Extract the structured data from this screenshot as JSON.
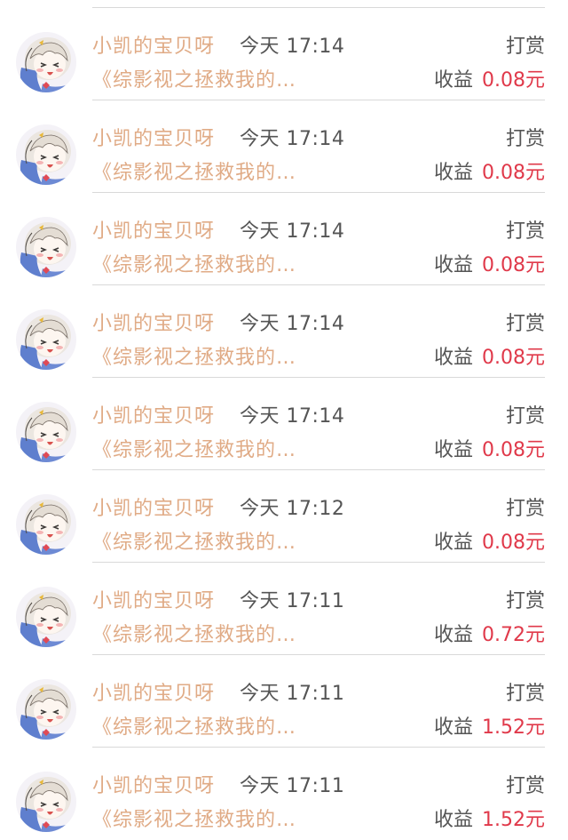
{
  "rows": [
    {
      "name": "小凯的宝贝呀",
      "time": "今天 17:14",
      "type": "打赏",
      "book": "《综影视之拯救我的…",
      "earn_label": "收益",
      "amount": "0.08元"
    },
    {
      "name": "小凯的宝贝呀",
      "time": "今天 17:14",
      "type": "打赏",
      "book": "《综影视之拯救我的…",
      "earn_label": "收益",
      "amount": "0.08元"
    },
    {
      "name": "小凯的宝贝呀",
      "time": "今天 17:14",
      "type": "打赏",
      "book": "《综影视之拯救我的…",
      "earn_label": "收益",
      "amount": "0.08元"
    },
    {
      "name": "小凯的宝贝呀",
      "time": "今天 17:14",
      "type": "打赏",
      "book": "《综影视之拯救我的…",
      "earn_label": "收益",
      "amount": "0.08元"
    },
    {
      "name": "小凯的宝贝呀",
      "time": "今天 17:14",
      "type": "打赏",
      "book": "《综影视之拯救我的…",
      "earn_label": "收益",
      "amount": "0.08元"
    },
    {
      "name": "小凯的宝贝呀",
      "time": "今天 17:12",
      "type": "打赏",
      "book": "《综影视之拯救我的…",
      "earn_label": "收益",
      "amount": "0.08元"
    },
    {
      "name": "小凯的宝贝呀",
      "time": "今天 17:11",
      "type": "打赏",
      "book": "《综影视之拯救我的…",
      "earn_label": "收益",
      "amount": "0.72元"
    },
    {
      "name": "小凯的宝贝呀",
      "time": "今天 17:11",
      "type": "打赏",
      "book": "《综影视之拯救我的…",
      "earn_label": "收益",
      "amount": "1.52元"
    },
    {
      "name": "小凯的宝贝呀",
      "time": "今天 17:11",
      "type": "打赏",
      "book": "《综影视之拯救我的…",
      "earn_label": "收益",
      "amount": "1.52元"
    }
  ],
  "colors": {
    "name": "#e0ab86",
    "book": "#e0ab86",
    "secondary_text": "#555555",
    "amount": "#e0394a",
    "divider": "#d9d9d9"
  },
  "icons": {
    "avatar": "anime-girl-avatar-icon"
  }
}
